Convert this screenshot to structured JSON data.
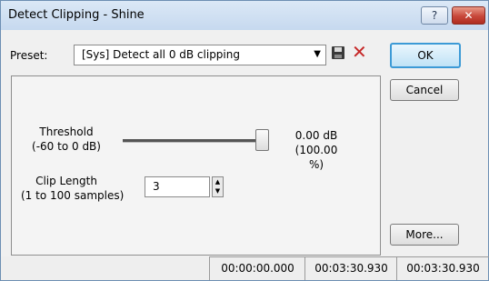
{
  "window": {
    "title": "Detect Clipping - Shine",
    "help_glyph": "?",
    "close_glyph": "✕"
  },
  "preset": {
    "label": "Preset:",
    "value": "[Sys] Detect all 0 dB clipping",
    "dropdown_glyph": "▼",
    "save_icon": "save-icon",
    "delete_glyph": "✕"
  },
  "buttons": {
    "ok": "OK",
    "cancel": "Cancel",
    "more": "More..."
  },
  "threshold": {
    "label_line1": "Threshold",
    "label_line2": "(-60 to 0 dB)",
    "value_db": "0.00 dB",
    "value_pct": "(100.00 %)",
    "slider_level": 1.0
  },
  "clip_length": {
    "label_line1": "Clip Length",
    "label_line2": "(1 to 100 samples)",
    "value": "3",
    "spin_glyph": "▲▼"
  },
  "status": {
    "start": "00:00:00.000",
    "end": "00:03:30.930",
    "length": "00:03:30.930"
  },
  "colors": {
    "ok_border": "#3c9ad6",
    "delete": "#c62828",
    "close_button": "#c7473a"
  }
}
